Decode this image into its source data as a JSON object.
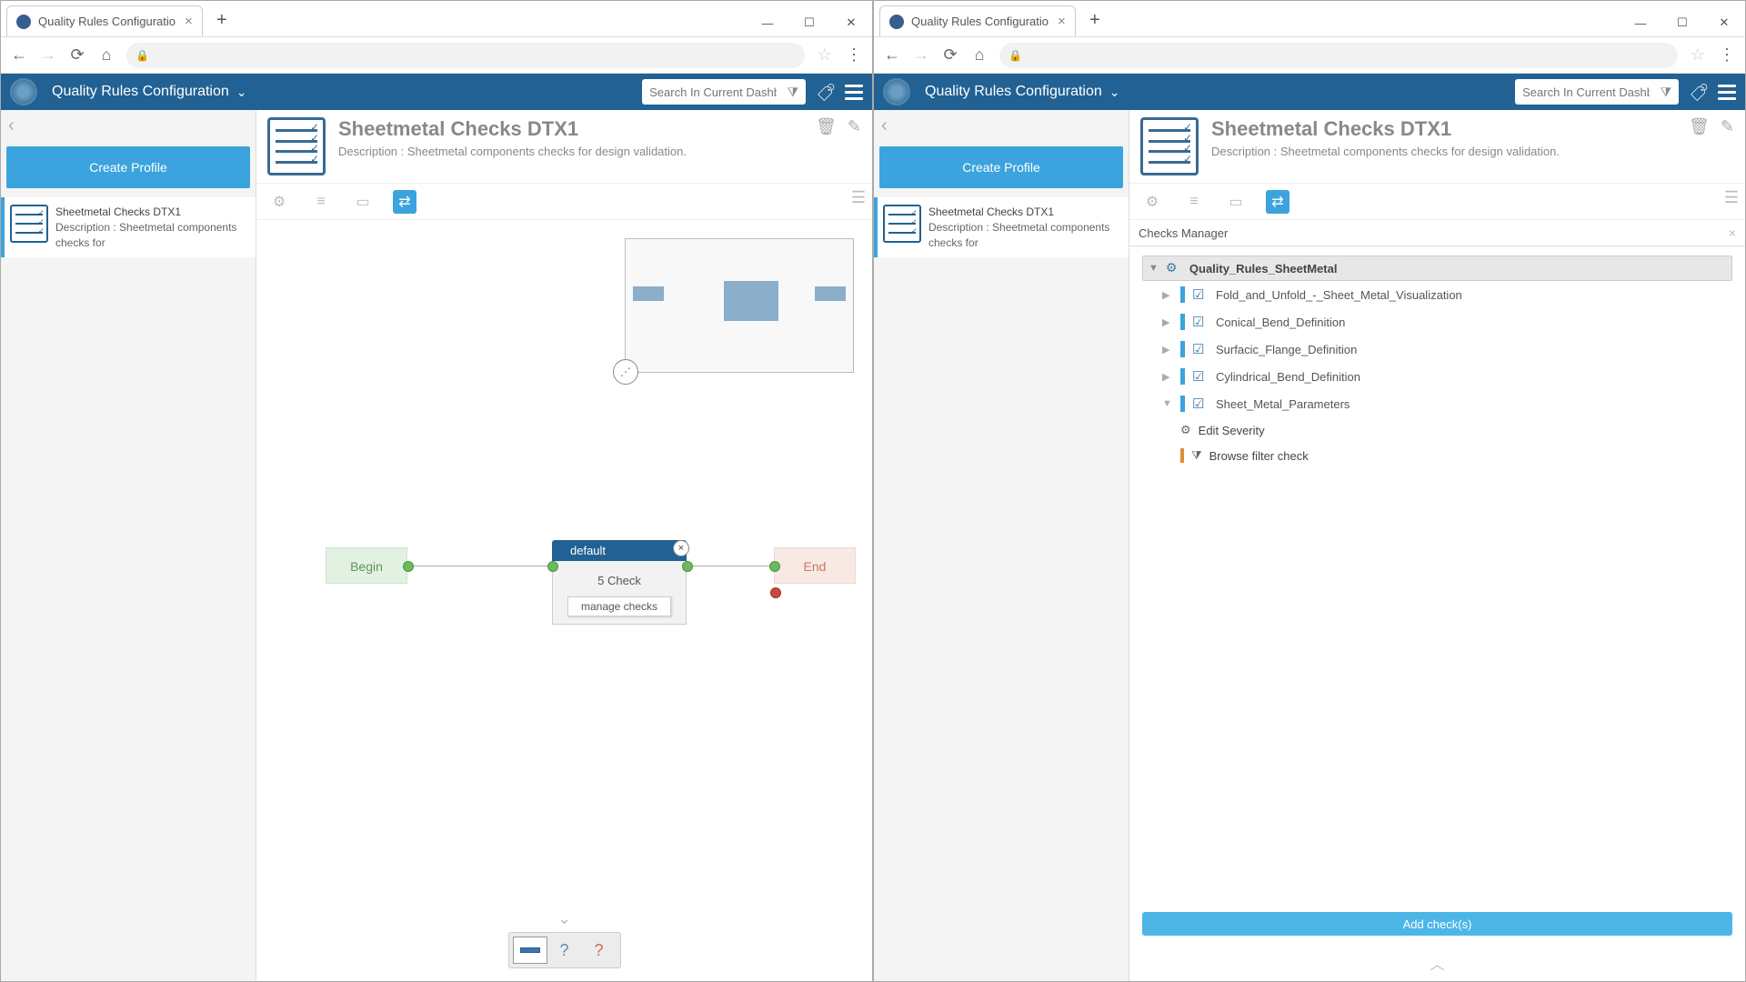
{
  "browser": {
    "tab_title": "Quality Rules Configuratio",
    "search_placeholder": "Search In Current Dashboar"
  },
  "app": {
    "title": "Quality Rules Configuration",
    "create_profile": "Create Profile"
  },
  "profile_card": {
    "title": "Sheetmetal Checks DTX1",
    "desc": "Description : Sheetmetal components checks for"
  },
  "header": {
    "title": "Sheetmetal Checks DTX1",
    "desc": "Description : Sheetmetal components checks for design validation."
  },
  "flow": {
    "begin": "Begin",
    "end": "End",
    "default": "default",
    "check_count": "5 Check",
    "manage": "manage checks"
  },
  "checks_mgr": {
    "title": "Checks Manager",
    "root": "Quality_Rules_SheetMetal",
    "items": [
      "Fold_and_Unfold_-_Sheet_Metal_Visualization",
      "Conical_Bend_Definition",
      "Surfacic_Flange_Definition",
      "Cylindrical_Bend_Definition",
      "Sheet_Metal_Parameters"
    ],
    "edit_severity": "Edit Severity",
    "browse_filter": "Browse filter check",
    "add_btn": "Add check(s)"
  }
}
